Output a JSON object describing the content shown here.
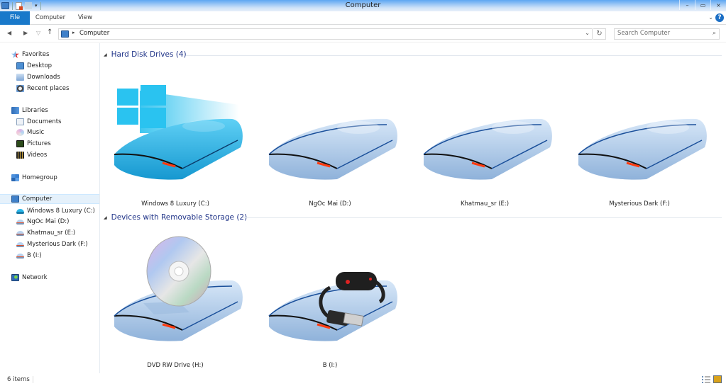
{
  "window": {
    "title": "Computer",
    "quick_access": [
      "app-icon",
      "properties-icon",
      "new-folder-icon",
      "customize-dropdown"
    ],
    "controls": {
      "minimize": "–",
      "maximize": "▭",
      "close": "×"
    }
  },
  "ribbon": {
    "tabs": [
      {
        "label": "File",
        "active": true
      },
      {
        "label": "Computer"
      },
      {
        "label": "View"
      }
    ],
    "expand_glyph": "⌄",
    "help_glyph": "?"
  },
  "navigation": {
    "back": "◀",
    "forward": "▶",
    "recent": "▽",
    "up": "↑",
    "breadcrumb_separator": "▸",
    "address": "Computer",
    "address_dropdown": "⌄",
    "refresh_glyph": "↻",
    "search_placeholder": "Search Computer",
    "search_glyph": "⌕"
  },
  "sidebar": {
    "favorites": {
      "label": "Favorites",
      "items": [
        {
          "label": "Desktop"
        },
        {
          "label": "Downloads"
        },
        {
          "label": "Recent places"
        }
      ]
    },
    "libraries": {
      "label": "Libraries",
      "items": [
        {
          "label": "Documents"
        },
        {
          "label": "Music"
        },
        {
          "label": "Pictures"
        },
        {
          "label": "Videos"
        }
      ]
    },
    "homegroup": {
      "label": "Homegroup"
    },
    "computer": {
      "label": "Computer",
      "selected": true,
      "items": [
        {
          "label": "Windows 8 Luxury (C:)"
        },
        {
          "label": "NgOc Mai (D:)"
        },
        {
          "label": "Khatmau_sr (E:)"
        },
        {
          "label": "Mysterious Dark (F:)"
        },
        {
          "label": "B (I:)"
        }
      ]
    },
    "network": {
      "label": "Network"
    }
  },
  "content": {
    "groups": [
      {
        "title": "Hard Disk Drives (4)",
        "items": [
          {
            "label": "Windows 8 Luxury (C:)",
            "icon": "windows-drive-icon",
            "color": "#29b6e8"
          },
          {
            "label": "NgOc Mai (D:)",
            "icon": "hard-drive-icon",
            "color": "#b8d2ef"
          },
          {
            "label": "Khatmau_sr (E:)",
            "icon": "hard-drive-icon",
            "color": "#b8d2ef"
          },
          {
            "label": "Mysterious Dark (F:)",
            "icon": "hard-drive-icon",
            "color": "#b8d2ef"
          }
        ]
      },
      {
        "title": "Devices with Removable Storage (2)",
        "items": [
          {
            "label": "DVD RW Drive (H:)",
            "icon": "dvd-drive-icon",
            "color": "#b8d2ef"
          },
          {
            "label": "B (I:)",
            "icon": "usb-drive-icon",
            "color": "#b8d2ef"
          }
        ]
      }
    ]
  },
  "status": {
    "item_count": "6 items"
  },
  "colors": {
    "accent": "#1979ca",
    "group_title": "#1e3287",
    "selection": "#e5f1fb"
  }
}
